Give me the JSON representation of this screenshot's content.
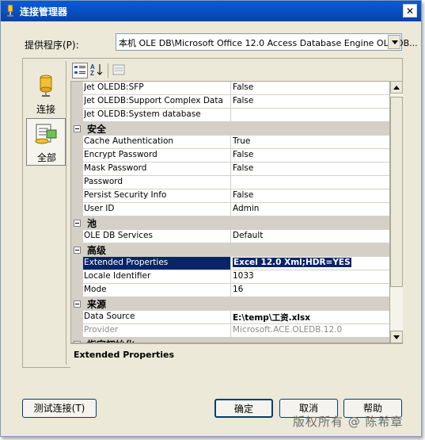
{
  "window": {
    "title": "连接管理器",
    "close_glyph": "✕"
  },
  "provider": {
    "label": "提供程序(P):",
    "value": "本机 OLE DB\\Microsoft Office 12.0 Access Database Engine OLE DB..."
  },
  "nav": [
    {
      "label": "连接"
    },
    {
      "label": "全部"
    }
  ],
  "grid": {
    "rows": [
      {
        "type": "prop",
        "name": "Jet OLEDB:SFP",
        "value": "False"
      },
      {
        "type": "prop",
        "name": "Jet OLEDB:Support Complex Data",
        "value": "False"
      },
      {
        "type": "prop",
        "name": "Jet OLEDB:System database",
        "value": ""
      },
      {
        "type": "cat",
        "name": "安全"
      },
      {
        "type": "prop",
        "name": "Cache Authentication",
        "value": "True"
      },
      {
        "type": "prop",
        "name": "Encrypt Password",
        "value": "False"
      },
      {
        "type": "prop",
        "name": "Mask Password",
        "value": "False"
      },
      {
        "type": "prop",
        "name": "Password",
        "value": ""
      },
      {
        "type": "prop",
        "name": "Persist Security Info",
        "value": "False"
      },
      {
        "type": "prop",
        "name": "User ID",
        "value": "Admin"
      },
      {
        "type": "cat",
        "name": "池"
      },
      {
        "type": "prop",
        "name": "OLE DB Services",
        "value": "Default"
      },
      {
        "type": "cat",
        "name": "高级"
      },
      {
        "type": "prop",
        "name": "Extended Properties",
        "value": "Excel 12.0 Xml;HDR=YES",
        "selected": true
      },
      {
        "type": "prop",
        "name": "Locale Identifier",
        "value": "1033"
      },
      {
        "type": "prop",
        "name": "Mode",
        "value": "16"
      },
      {
        "type": "cat",
        "name": "来源"
      },
      {
        "type": "prop",
        "name": "Data Source",
        "value": "E:\\temp\\工资.xlsx",
        "bold": true
      },
      {
        "type": "prop",
        "name": "Provider",
        "value": "Microsoft.ACE.OLEDB.12.0",
        "dim": true
      },
      {
        "type": "cat",
        "name": "指定初始化"
      }
    ]
  },
  "description": {
    "title": "Extended Properties"
  },
  "buttons": {
    "test": "测试连接(T)",
    "ok": "确定",
    "cancel": "取消",
    "help": "帮助"
  },
  "watermark": "版权所有 @ 陈希章",
  "colors": {
    "titlebar": "#0a5bd8",
    "selection": "#0a246a",
    "dialog_bg": "#ece9d8"
  }
}
